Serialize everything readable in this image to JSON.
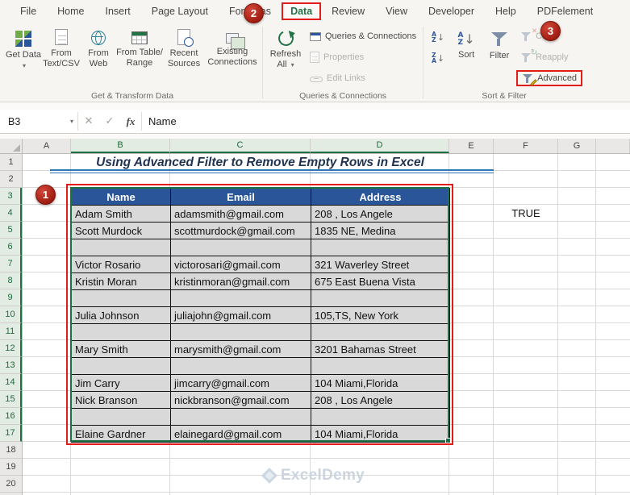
{
  "ribbon": {
    "tabs": [
      "File",
      "Home",
      "Insert",
      "Page Layout",
      "Formulas",
      "Data",
      "Review",
      "View",
      "Developer",
      "Help",
      "PDFelement"
    ],
    "active_tab": "Data",
    "group_labels": [
      "Get & Transform Data",
      "Queries & Connections",
      "Sort & Filter"
    ],
    "buttons": {
      "get_data": "Get Data",
      "from_text_csv": "From Text/CSV",
      "from_web": "From Web",
      "from_table_range": "From Table/ Range",
      "recent_sources": "Recent Sources",
      "existing_connections": "Existing Connections",
      "refresh_all": "Refresh All",
      "queries_connections": "Queries & Connections",
      "properties": "Properties",
      "edit_links": "Edit Links",
      "sort": "Sort",
      "filter": "Filter",
      "clear": "Clear",
      "reapply": "Reapply",
      "advanced": "Advanced"
    }
  },
  "formula_bar": {
    "name_box": "B3",
    "formula": "Name"
  },
  "icons": {
    "dropdown": "▾",
    "cancel": "✕",
    "enter": "✓",
    "fx": "fx",
    "sort_down_arrow": "↓",
    "refresh": "↻",
    "letter_a": "A",
    "letter_z": "Z"
  },
  "sheet": {
    "title": "Using Advanced Filter to Remove Empty Rows in Excel",
    "col_headers": [
      "A",
      "B",
      "C",
      "D",
      "E",
      "F",
      "G"
    ],
    "row_headers": [
      "1",
      "2",
      "3",
      "4",
      "5",
      "6",
      "7",
      "8",
      "9",
      "10",
      "11",
      "12",
      "13",
      "14",
      "15",
      "16",
      "17",
      "18",
      "19",
      "20"
    ],
    "table": {
      "headers": [
        "Name",
        "Email",
        "Address"
      ],
      "rows": [
        [
          "Adam Smith",
          "adamsmith@gmail.com",
          "208 , Los Angele"
        ],
        [
          "Scott Murdock",
          "scottmurdock@gmail.com",
          "1835  NE, Medina"
        ],
        [
          "",
          "",
          ""
        ],
        [
          "Victor Rosario",
          "victorosari@gmail.com",
          "321 Waverley Street"
        ],
        [
          "Kristin Moran",
          "kristinmoran@gmail.com",
          "675 East Buena Vista"
        ],
        [
          "",
          "",
          ""
        ],
        [
          "Julia Johnson",
          "juliajohn@gmail.com",
          "105,TS, New York"
        ],
        [
          "",
          "",
          ""
        ],
        [
          "Mary Smith",
          "marysmith@gmail.com",
          "3201 Bahamas Street"
        ],
        [
          "",
          "",
          ""
        ],
        [
          "Jim Carry",
          "jimcarry@gmail.com",
          "104 Miami,Florida"
        ],
        [
          "Nick Branson",
          "nickbranson@gmail.com",
          "208 , Los Angele"
        ],
        [
          "",
          "",
          ""
        ],
        [
          "Elaine Gardner",
          "elainegard@gmail.com",
          "104 Miami,Florida"
        ]
      ]
    },
    "cells": {
      "F4": "TRUE"
    },
    "watermark": "ExcelDemy"
  },
  "annotations": {
    "badges": [
      "1",
      "2",
      "3"
    ]
  },
  "colors": {
    "annotation_red": "#e31b1b",
    "badge_red": "#9c1a0e",
    "table_header_blue": "#2a5699",
    "table_cell_gray": "#d9d9d9",
    "selection_green": "#1e7145",
    "title_blue": "#2e74b5",
    "excel_green": "#217346"
  }
}
